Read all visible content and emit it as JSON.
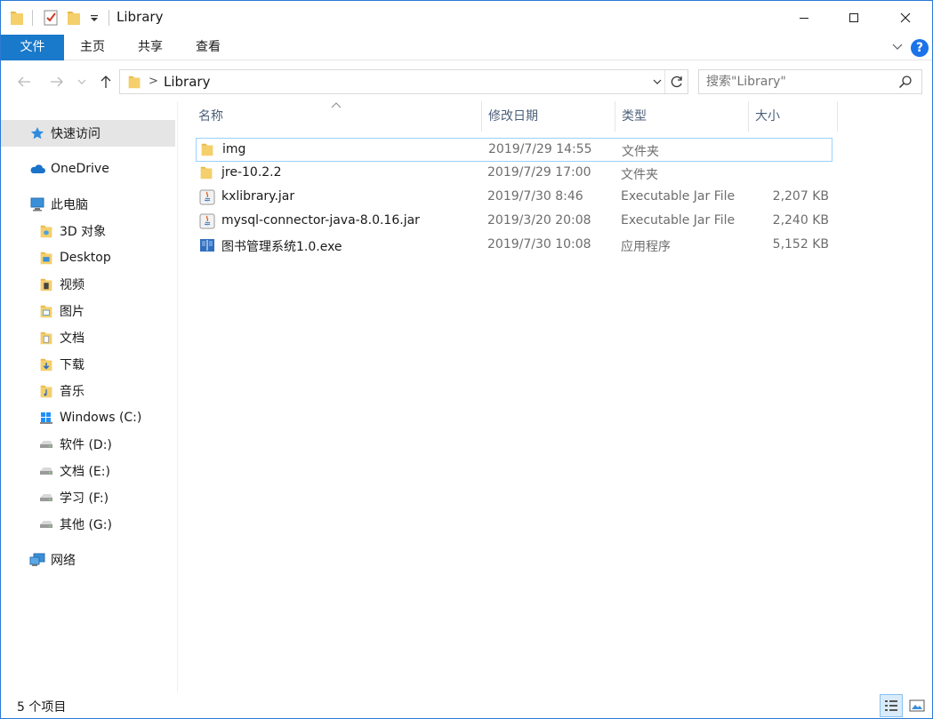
{
  "window": {
    "title": "Library"
  },
  "ribbon": {
    "tabs": [
      {
        "label": "文件"
      },
      {
        "label": "主页"
      },
      {
        "label": "共享"
      },
      {
        "label": "查看"
      }
    ],
    "help": "?"
  },
  "address": {
    "path": "Library",
    "separator": ">"
  },
  "search": {
    "placeholder": "搜索\"Library\""
  },
  "nav": {
    "items": [
      {
        "label": "快速访问",
        "icon": "star-icon"
      },
      {
        "label": "OneDrive",
        "icon": "cloud-icon"
      },
      {
        "label": "此电脑",
        "icon": "computer-icon"
      },
      {
        "label": "3D 对象",
        "icon": "folder-3d-icon"
      },
      {
        "label": "Desktop",
        "icon": "desktop-folder-icon"
      },
      {
        "label": "视频",
        "icon": "video-folder-icon"
      },
      {
        "label": "图片",
        "icon": "pictures-folder-icon"
      },
      {
        "label": "文档",
        "icon": "documents-folder-icon"
      },
      {
        "label": "下载",
        "icon": "downloads-folder-icon"
      },
      {
        "label": "音乐",
        "icon": "music-folder-icon"
      },
      {
        "label": "Windows (C:)",
        "icon": "windows-drive-icon"
      },
      {
        "label": "软件 (D:)",
        "icon": "drive-icon"
      },
      {
        "label": "文档 (E:)",
        "icon": "drive-icon"
      },
      {
        "label": "学习 (F:)",
        "icon": "drive-icon"
      },
      {
        "label": "其他 (G:)",
        "icon": "drive-icon"
      },
      {
        "label": "网络",
        "icon": "network-icon"
      }
    ]
  },
  "columns": {
    "name": "名称",
    "modified": "修改日期",
    "type": "类型",
    "size": "大小"
  },
  "files": [
    {
      "name": "img",
      "modified": "2019/7/29 14:55",
      "type": "文件夹",
      "size": "",
      "icon": "folder-icon"
    },
    {
      "name": "jre-10.2.2",
      "modified": "2019/7/29 17:00",
      "type": "文件夹",
      "size": "",
      "icon": "folder-icon"
    },
    {
      "name": "kxlibrary.jar",
      "modified": "2019/7/30 8:46",
      "type": "Executable Jar File",
      "size": "2,207 KB",
      "icon": "java-jar-icon"
    },
    {
      "name": "mysql-connector-java-8.0.16.jar",
      "modified": "2019/3/20 20:08",
      "type": "Executable Jar File",
      "size": "2,240 KB",
      "icon": "java-jar-icon"
    },
    {
      "name": "图书管理系统1.0.exe",
      "modified": "2019/7/30 10:08",
      "type": "应用程序",
      "size": "5,152 KB",
      "icon": "book-app-icon"
    }
  ],
  "status": {
    "item_count": "5 个项目"
  },
  "colors": {
    "accent": "#1979ca",
    "folder": "#e8b84a",
    "selection": "#e5e5e5",
    "header_text": "#4c607a"
  }
}
